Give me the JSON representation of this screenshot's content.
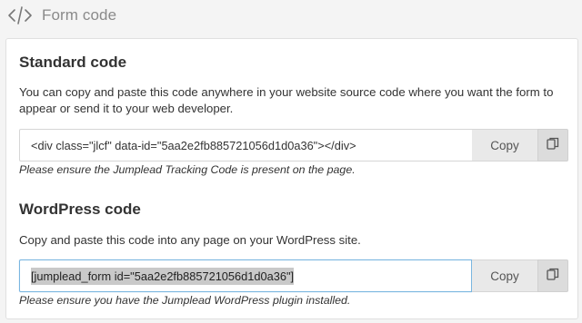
{
  "header": {
    "title": "Form code",
    "icon": "code-icon"
  },
  "standard": {
    "title": "Standard code",
    "description": "You can copy and paste this code anywhere in your website source code where you want the form to appear or send it to your web developer.",
    "code": "<div class=\"jlcf\" data-id=\"5aa2e2fb885721056d1d0a36\"></div>",
    "copy_label": "Copy",
    "note": "Please ensure the Jumplead Tracking Code is present on the page."
  },
  "wordpress": {
    "title": "WordPress code",
    "description": "Copy and paste this code into any page on your WordPress site.",
    "code": "[jumplead_form id=\"5aa2e2fb885721056d1d0a36\"]",
    "copy_label": "Copy",
    "note": "Please ensure you have the Jumplead WordPress plugin installed."
  },
  "colors": {
    "background": "#f4f4f4",
    "card": "#ffffff",
    "focus_border": "#7ab6e0",
    "copy_button": "#e9e9e9",
    "selection": "#c9c9c9"
  }
}
